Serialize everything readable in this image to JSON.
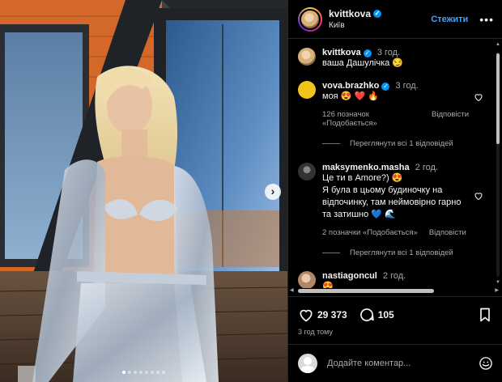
{
  "post": {
    "username": "kvittkova",
    "location": "Київ",
    "follow_label": "Стежити",
    "more_label": "•••",
    "verified_glyph": "✓",
    "caption": "ваша Дашулічка 😏",
    "caption_time": "3 год.",
    "likes": "29 373",
    "comments_count": "105",
    "posted_ago": "3 год тому",
    "carousel": {
      "slides": 8,
      "active": 0
    },
    "next_glyph": "›"
  },
  "comments": [
    {
      "username": "vova.brazhko",
      "verified": true,
      "time": "3 год.",
      "text": "моя 😍 ❤️ 🔥",
      "likes_label": "126 позначок «Подобається»",
      "reply_label": "Відповісти",
      "view_replies": "Переглянути всі 1 відповідей",
      "avatar_color": "#f0c419"
    },
    {
      "username": "maksymenko.masha",
      "verified": false,
      "time": "2 год.",
      "text": "Це ти в Amore?) 😍\nЯ була в цьому будиночку на відпочинку, там неймовірно гарно та затишно 💙 🌊",
      "likes_label": "2 позначки «Подобається»",
      "reply_label": "Відповісти",
      "view_replies": "Переглянути всі 1 відповідей",
      "avatar_color": "#444444"
    },
    {
      "username": "nastiagoncul",
      "verified": false,
      "time": "2 год.",
      "text": "😍",
      "avatar_color": "#c9a48a"
    }
  ],
  "add_comment": {
    "placeholder": "Додайте коментар..."
  },
  "colors": {
    "accent": "#0095f6",
    "follow": "#4a9ff5",
    "background": "#000000",
    "muted": "#a8a8a8"
  },
  "icons": [
    "heart-icon",
    "comment-icon",
    "bookmark-icon",
    "more-icon",
    "verified-icon",
    "emoji-icon",
    "chevron-right-icon"
  ]
}
